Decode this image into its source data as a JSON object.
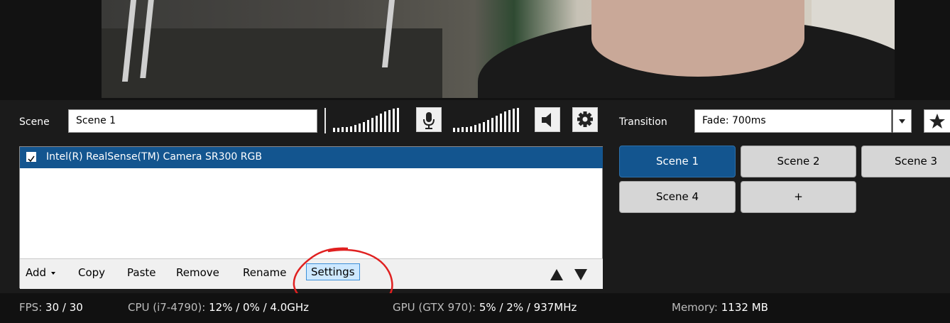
{
  "toolbar": {
    "scene_label": "Scene",
    "scene_name": "Scene 1",
    "transition_label": "Transition",
    "transition_value": "Fade: 700ms"
  },
  "sources": {
    "items": [
      {
        "label": "Intel(R) RealSense(TM) Camera SR300 RGB",
        "checked": true,
        "selected": true
      }
    ],
    "buttons": {
      "add": "Add",
      "copy": "Copy",
      "paste": "Paste",
      "remove": "Remove",
      "rename": "Rename",
      "settings": "Settings"
    }
  },
  "scenes": {
    "buttons": [
      "Scene 1",
      "Scene 2",
      "Scene 3",
      "Scene 4",
      "+"
    ],
    "active": "Scene 1"
  },
  "status": {
    "fps_label": "FPS:",
    "fps_value": "30 / 30",
    "cpu_label": "CPU (i7-4790):",
    "cpu_value": "12% / 0% / 4.0GHz",
    "gpu_label": "GPU (GTX 970):",
    "gpu_value": "5% / 2% / 937MHz",
    "memory_label": "Memory:",
    "memory_value": "1132 MB"
  },
  "icons": {
    "mic": "microphone-icon",
    "speaker": "speaker-icon",
    "settings": "gear-icon",
    "favorite": "star-icon",
    "dropdown": "chevron-down-icon"
  },
  "colors": {
    "accent": "#13558f",
    "background": "#1b1b1b",
    "annotation": "#e02020"
  }
}
